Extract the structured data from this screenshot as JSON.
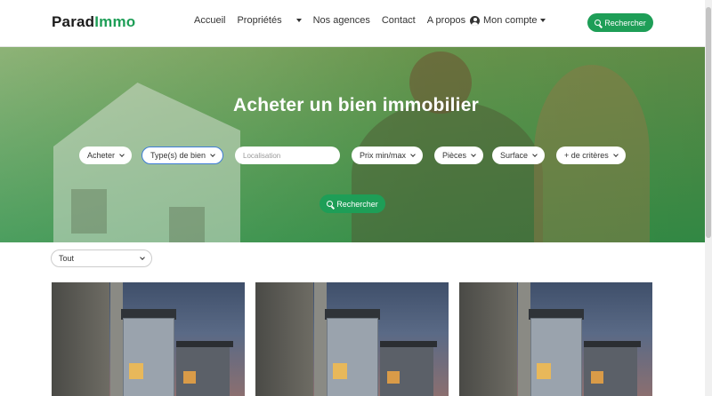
{
  "brand": {
    "part1": "Parad",
    "part2": "Immo"
  },
  "nav": {
    "items": [
      "Accueil",
      "Propriétés",
      "Nos agences",
      "Contact",
      "A propos"
    ],
    "account": "Mon compte",
    "search_button": "Rechercher"
  },
  "hero": {
    "title": "Acheter un bien immobilier",
    "filters": {
      "type": "Acheter",
      "property": "Type(s) de bien",
      "location_placeholder": "Localisation",
      "price": "Prix min/max",
      "rooms": "Pièces",
      "surface": "Surface",
      "more": "+ de critères"
    },
    "search_button": "Rechercher"
  },
  "listing": {
    "filter_value": "Tout",
    "cards": [
      {
        "alt": "property-photo"
      },
      {
        "alt": "property-photo"
      },
      {
        "alt": "property-photo"
      }
    ]
  },
  "colors": {
    "brand_green": "#1e9e57",
    "focus_blue": "#3d7cd6"
  },
  "icons": [
    "search-icon",
    "user-icon",
    "chevron-down-icon"
  ]
}
